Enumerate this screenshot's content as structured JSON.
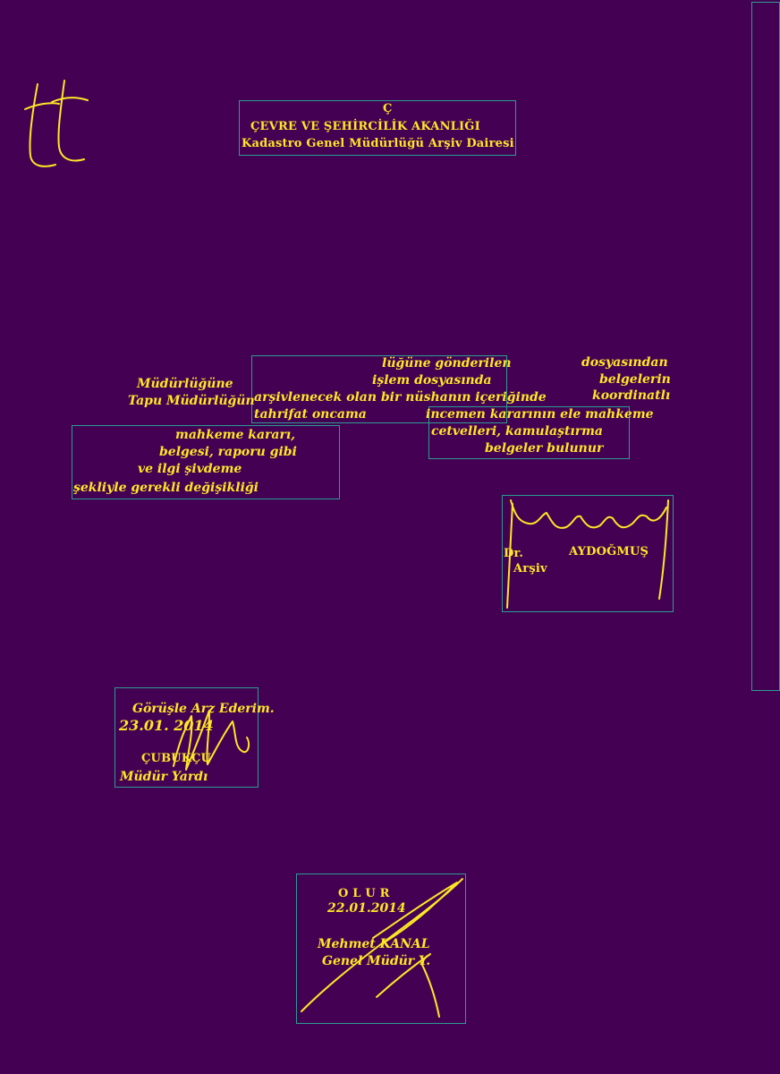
{
  "header": {
    "logo_icon": "tt-logo-mark",
    "line1": "Ç",
    "line2": "ÇEVRE VE ŞEHİRCİLİK   AKANLIĞI",
    "line3": "Kadastro Genel Müdürlüğü Arşiv Dairesi"
  },
  "body": {
    "upper": [
      "lüğüne gönderilen",
      "işlem dosyasında",
      "arşivlenecek olan bir nüshanın içeriğinde",
      "tahrifat          oncama"
    ],
    "left": [
      "Müdürlüğüne",
      "Tapu  Müdürlüğün"
    ],
    "right": [
      "dosyasından",
      "belgelerin",
      "koordinatlı"
    ],
    "middle_right": [
      "incemen  kararının  ele  mahkeme",
      "cetvelleri,  kamulaştırma",
      "belgeler bulunur"
    ],
    "lower_left": [
      "mahkeme  kararı,",
      "belgesi,                  raporu gibi",
      "ve  ilgi                              şivdeme",
      "şekliyle gerekli değişikliği"
    ]
  },
  "signature_block_1": {
    "prefix": "Dr.",
    "name": "AYDOĞMUŞ",
    "title": "Arşiv"
  },
  "approval_1": {
    "line1": "Görüşle Arz Ederim.",
    "date": "23.01. 2014",
    "name": "ÇUBUKÇU",
    "title": "Müdür Yardı"
  },
  "approval_2": {
    "line1": "O L U R",
    "date": "22.01.2014",
    "name": "Mehmet KANAL",
    "title": "Genel Müdür Y."
  },
  "colors": {
    "background": "#440154",
    "ink": "#fde725",
    "box_outline": "#2a9d8f"
  }
}
